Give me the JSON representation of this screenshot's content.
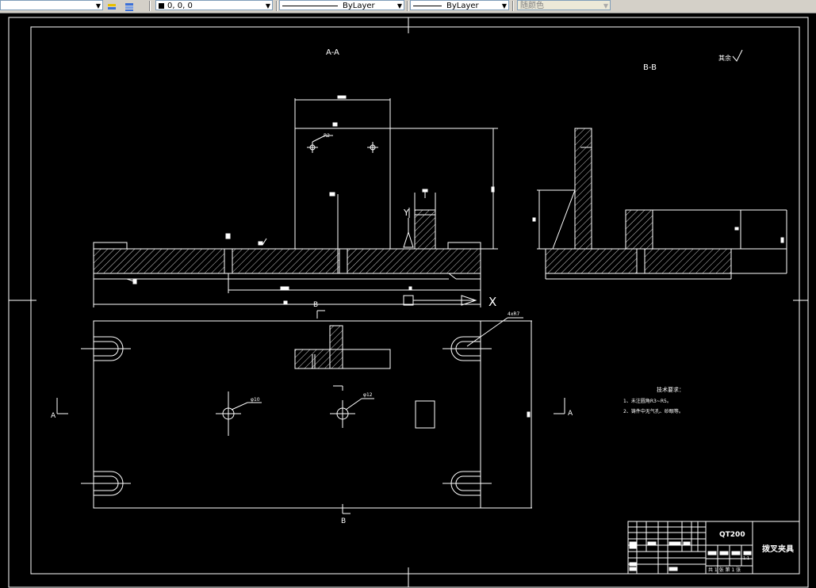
{
  "toolbar": {
    "color_value": "0, 0, 0",
    "linetype_value": "ByLayer",
    "lineweight_value": "ByLayer",
    "plotstyle_value": "随颜色"
  },
  "drawing": {
    "section_aa": "A-A",
    "section_bb": "B-B",
    "roughness_other": "其余",
    "cut_marker_a_left": "A",
    "cut_marker_a_right": "A",
    "cut_marker_b_top": "B",
    "cut_marker_b_bottom": "B",
    "dim_4xr7": "4xR7",
    "dim_phi10": "φ10",
    "dim_phi12": "φ12",
    "dim_r2": "R2",
    "tech_req_title": "技术要求：",
    "tech_req_1": "1、未注圆角R3~R5。",
    "tech_req_2": "2、铸件中无气孔、砂眼等。",
    "ucs_y": "Y",
    "ucs_x": "X"
  },
  "title_block": {
    "part_code": "QT200",
    "part_name": "拨叉夹具",
    "scale_label": "1:1",
    "sheet_info": "共 1 张 第 1 张"
  }
}
